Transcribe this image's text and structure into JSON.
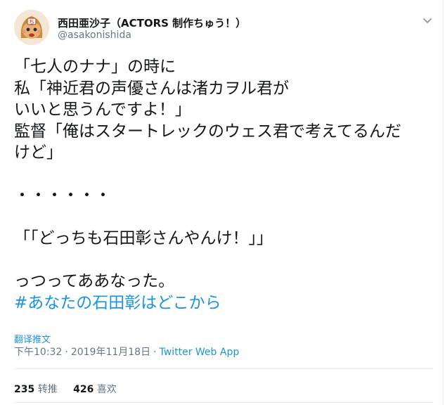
{
  "tweet": {
    "author_name": "西田亜沙子（ACTORS 制作ちゅう！）",
    "author_handle": "@asakonishida",
    "avatar_icon": "avatar-character-icon",
    "menu_icon": "chevron-down-icon",
    "lines": [
      "「七人のナナ」の時に",
      "私「神近君の声優さんは渚カヲル君が",
      "いいと思うんですよ！」",
      "監督「俺はスタートレックのウェス君で考えてるんだ",
      "けど」",
      "",
      "・・・・・・",
      "",
      "「「どっちも石田彰さんやんけ！」」",
      "",
      "っつってああなった。"
    ],
    "hashtag": "#あなたの石田彰はどこから",
    "translate_label": "翻译推文",
    "time": "下午10:32",
    "date": "2019年11月18日",
    "separator": "·",
    "source": "Twitter Web App",
    "retweets_count": "235",
    "retweets_label": "转推",
    "likes_count": "426",
    "likes_label": "喜欢"
  },
  "colors": {
    "link": "#1b95e0",
    "secondary": "#657786",
    "text": "#14171a",
    "divider": "#e6ecf0"
  }
}
